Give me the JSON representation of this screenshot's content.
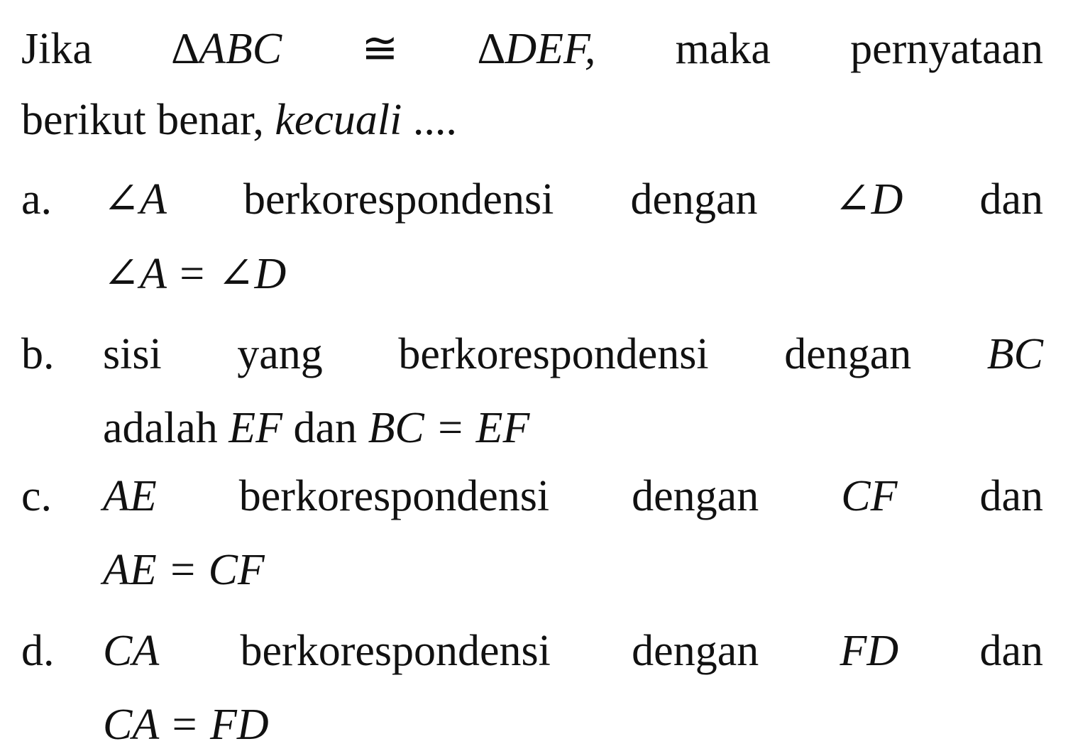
{
  "question": {
    "line1": [
      "Jika",
      "∆ABC",
      "≅",
      "∆DEF,",
      "maka",
      "pernyataan"
    ],
    "line2_text": "berikut benar,",
    "line2_italic": "kecuali",
    "line2_end": "...."
  },
  "options": [
    {
      "label": "a.",
      "line1": [
        "∠A",
        "berkorespondensi",
        "dengan",
        "∠D",
        "dan"
      ],
      "line2": "∠A = ∠D"
    },
    {
      "label": "b.",
      "line1": [
        "sisi",
        "yang",
        "berkorespondensi",
        "dengan",
        "BC"
      ],
      "line2_a": "adalah",
      "line2_b": "EF",
      "line2_c": "dan",
      "line2_d": "BC = EF"
    },
    {
      "label": "c.",
      "line1": [
        "AE",
        "berkorespondensi",
        "dengan",
        "CF",
        "dan"
      ],
      "line2": "AE = CF"
    },
    {
      "label": "d.",
      "line1": [
        "CA",
        "berkorespondensi",
        "dengan",
        "FD",
        "dan"
      ],
      "line2": "CA = FD"
    }
  ]
}
